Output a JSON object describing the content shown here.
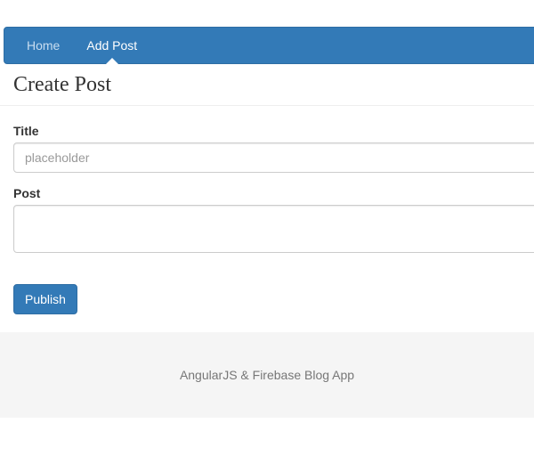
{
  "nav": {
    "items": [
      {
        "label": "Home",
        "active": false
      },
      {
        "label": "Add Post",
        "active": true
      }
    ]
  },
  "header": {
    "title": "Create Post"
  },
  "form": {
    "title_label": "Title",
    "title_placeholder": "placeholder",
    "title_value": "",
    "post_label": "Post",
    "post_value": "",
    "submit_label": "Publish"
  },
  "footer": {
    "text": "AngularJS & Firebase Blog App"
  }
}
